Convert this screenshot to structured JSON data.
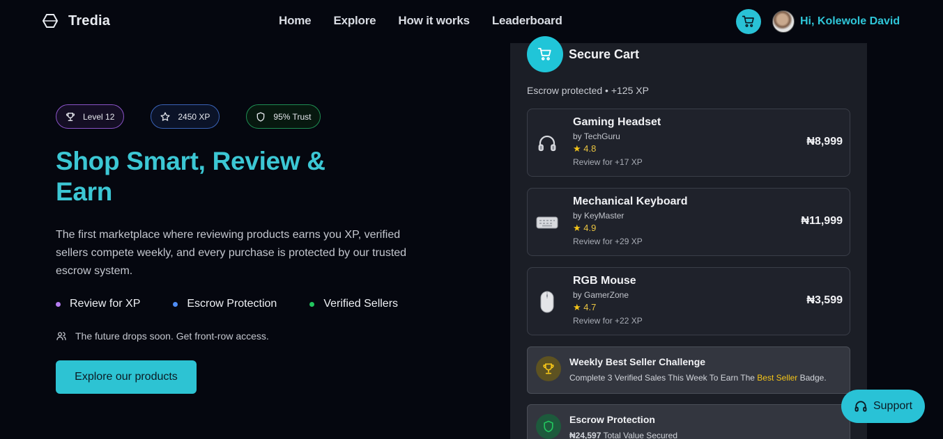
{
  "brand": {
    "name": "Tredia"
  },
  "nav": {
    "links": [
      "Home",
      "Explore",
      "How it works",
      "Leaderboard"
    ],
    "user_greeting": "Hi, Kolewole David"
  },
  "hero": {
    "badges": [
      {
        "label": "Level 12",
        "icon": "trophy-icon"
      },
      {
        "label": "2450 XP",
        "icon": "star-icon"
      },
      {
        "label": "95% Trust",
        "icon": "shield-icon"
      }
    ],
    "title_line1": "Shop Smart, Review &",
    "title_line2": "Earn",
    "description": "The first marketplace where reviewing products earns you XP, verified sellers compete weekly, and every purchase is protected by our trusted escrow system.",
    "features": [
      {
        "label": "Review for XP",
        "color": "#b57cf0"
      },
      {
        "label": "Escrow Protection",
        "color": "#4f8df5"
      },
      {
        "label": "Verified Sellers",
        "color": "#22c55e"
      }
    ],
    "note": "The future drops soon. Get front-row access.",
    "cta_label": "Explore our products"
  },
  "cart": {
    "title": "Secure Cart",
    "subtitle": "Escrow protected  •  +125 XP",
    "items": [
      {
        "name": "Gaming Headset",
        "seller": "by TechGuru",
        "rating": "4.8",
        "review": "Review for +17 XP",
        "price": "₦8,999",
        "icon": "headphones-icon"
      },
      {
        "name": "Mechanical Keyboard",
        "seller": "by KeyMaster",
        "rating": "4.9",
        "review": "Review for +29 XP",
        "price": "₦11,999",
        "icon": "keyboard-icon"
      },
      {
        "name": "RGB Mouse",
        "seller": "by GamerZone",
        "rating": "4.7",
        "review": "Review for +22 XP",
        "price": "₦3,599",
        "icon": "mouse-icon"
      }
    ],
    "challenge": {
      "title": "Weekly Best Seller Challenge",
      "text_before": "Complete 3 Verified Sales This Week To Earn The ",
      "highlight": "Best Seller",
      "text_after": " Badge."
    },
    "escrow": {
      "title": "Escrow Protection",
      "amount": "₦24,597",
      "amount_label": " Total Value Secured"
    }
  },
  "support": {
    "label": "Support"
  },
  "colors": {
    "accent": "#29c2d6",
    "background": "#05070f",
    "panel": "#1b1e26",
    "star": "#f5c518"
  }
}
